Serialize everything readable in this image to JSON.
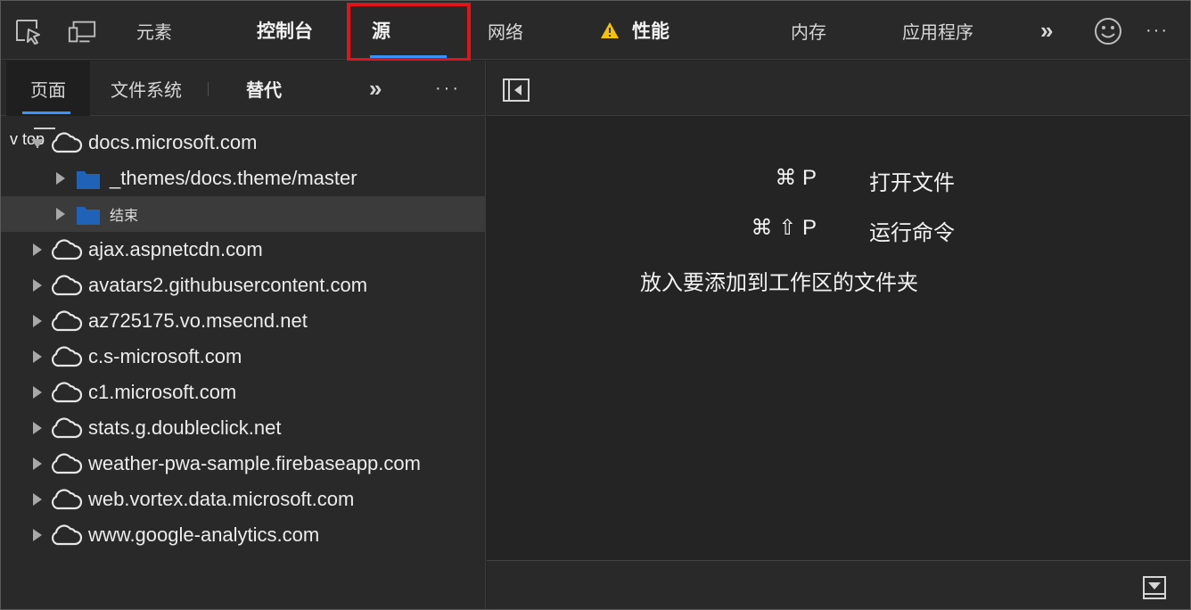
{
  "top_tabs": {
    "elements": "元素",
    "console": "控制台",
    "sources": "源",
    "network": "网络",
    "performance": "性能",
    "memory": "内存",
    "application": "应用程序",
    "more": "»",
    "menu": "···"
  },
  "sub_tabs": {
    "page": "页面",
    "filesystem": "文件系统",
    "overrides": "替代",
    "more": "»",
    "menu": "···"
  },
  "tree": {
    "root": "v top",
    "items": [
      {
        "label": "docs.microsoft.com",
        "level": 1,
        "expanded": true,
        "type": "cloud"
      },
      {
        "label": "_themes/docs.theme/master",
        "level": 2,
        "expanded": false,
        "type": "folder"
      },
      {
        "label": "结束",
        "level": 2,
        "expanded": false,
        "type": "folder",
        "selected": true
      },
      {
        "label": "ajax.aspnetcdn.com",
        "level": 1,
        "expanded": false,
        "type": "cloud"
      },
      {
        "label": "avatars2.githubusercontent.com",
        "level": 1,
        "expanded": false,
        "type": "cloud"
      },
      {
        "label": "az725175.vo.msecnd.net",
        "level": 1,
        "expanded": false,
        "type": "cloud"
      },
      {
        "label": "c.s-microsoft.com",
        "level": 1,
        "expanded": false,
        "type": "cloud"
      },
      {
        "label": "c1.microsoft.com",
        "level": 1,
        "expanded": false,
        "type": "cloud"
      },
      {
        "label": "stats.g.doubleclick.net",
        "level": 1,
        "expanded": false,
        "type": "cloud"
      },
      {
        "label": "weather-pwa-sample.firebaseapp.com",
        "level": 1,
        "expanded": false,
        "type": "cloud"
      },
      {
        "label": "web.vortex.data.microsoft.com",
        "level": 1,
        "expanded": false,
        "type": "cloud"
      },
      {
        "label": "www.google-analytics.com",
        "level": 1,
        "expanded": false,
        "type": "cloud"
      }
    ]
  },
  "editor": {
    "shortcut1_keys": "⌘ P",
    "shortcut1_action": "打开文件",
    "shortcut2_keys": "⌘ ⇧ P",
    "shortcut2_action": "运行命令",
    "drop_hint": "放入要添加到工作区的文件夹"
  },
  "colors": {
    "accent": "#3794ff",
    "highlight": "#e0141b",
    "warning": "#f5c400",
    "folder": "#1e63b8"
  },
  "icons": {
    "inspect": "inspect-element-icon",
    "device": "device-emulation-icon",
    "warning": "warning-icon",
    "feedback": "smiley-feedback-icon",
    "navigator_toggle": "sidebar-toggle-icon",
    "drawer_toggle": "drawer-toggle-icon"
  }
}
